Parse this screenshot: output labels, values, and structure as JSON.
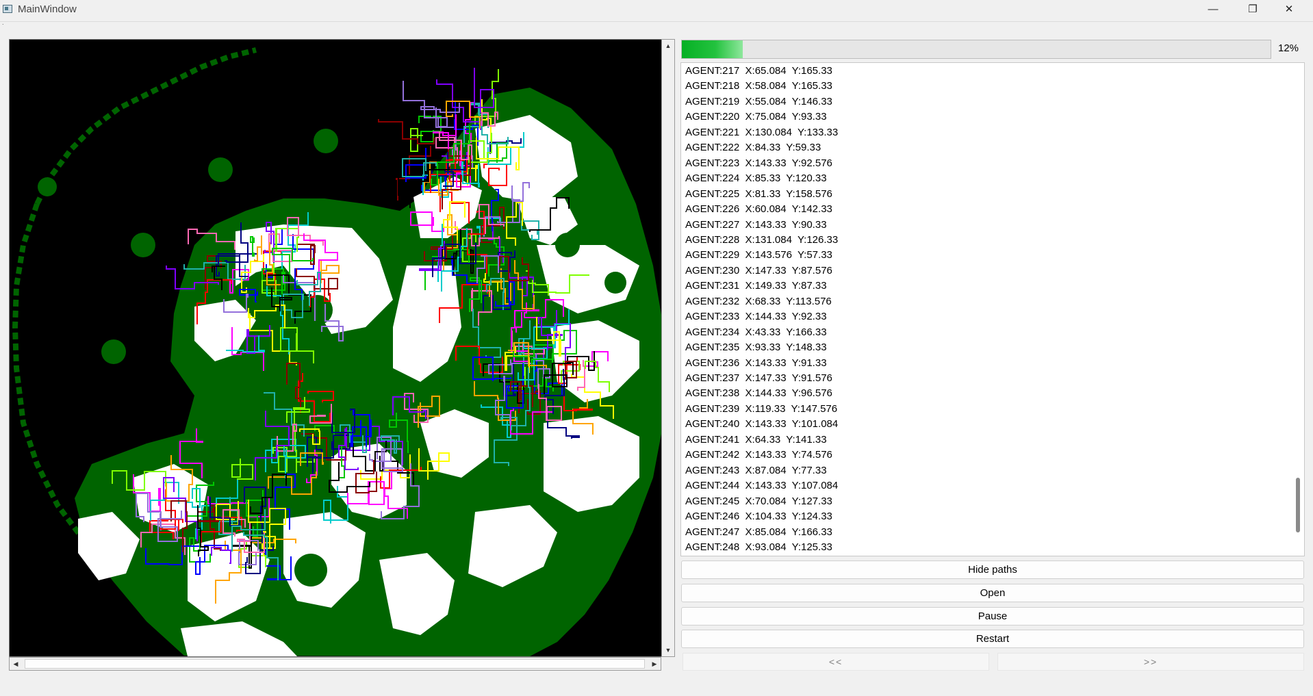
{
  "window": {
    "title": "MainWindow",
    "controls": {
      "minimize": "—",
      "restore": "❐",
      "close": "✕"
    },
    "menu_marker": "."
  },
  "progress": {
    "value": 0.12,
    "label": "12%",
    "fill_color": "#06b025"
  },
  "agents": [
    {
      "label": "AGENT:217  X:65.084  Y:165.33"
    },
    {
      "label": "AGENT:218  X:58.084  Y:165.33"
    },
    {
      "label": "AGENT:219  X:55.084  Y:146.33"
    },
    {
      "label": "AGENT:220  X:75.084  Y:93.33"
    },
    {
      "label": "AGENT:221  X:130.084  Y:133.33"
    },
    {
      "label": "AGENT:222  X:84.33  Y:59.33"
    },
    {
      "label": "AGENT:223  X:143.33  Y:92.576"
    },
    {
      "label": "AGENT:224  X:85.33  Y:120.33"
    },
    {
      "label": "AGENT:225  X:81.33  Y:158.576"
    },
    {
      "label": "AGENT:226  X:60.084  Y:142.33"
    },
    {
      "label": "AGENT:227  X:143.33  Y:90.33"
    },
    {
      "label": "AGENT:228  X:131.084  Y:126.33"
    },
    {
      "label": "AGENT:229  X:143.576  Y:57.33"
    },
    {
      "label": "AGENT:230  X:147.33  Y:87.576"
    },
    {
      "label": "AGENT:231  X:149.33  Y:87.33"
    },
    {
      "label": "AGENT:232  X:68.33  Y:113.576"
    },
    {
      "label": "AGENT:233  X:144.33  Y:92.33"
    },
    {
      "label": "AGENT:234  X:43.33  Y:166.33"
    },
    {
      "label": "AGENT:235  X:93.33  Y:148.33"
    },
    {
      "label": "AGENT:236  X:143.33  Y:91.33"
    },
    {
      "label": "AGENT:237  X:147.33  Y:91.576"
    },
    {
      "label": "AGENT:238  X:144.33  Y:96.576"
    },
    {
      "label": "AGENT:239  X:119.33  Y:147.576"
    },
    {
      "label": "AGENT:240  X:143.33  Y:101.084"
    },
    {
      "label": "AGENT:241  X:64.33  Y:141.33"
    },
    {
      "label": "AGENT:242  X:143.33  Y:74.576"
    },
    {
      "label": "AGENT:243  X:87.084  Y:77.33"
    },
    {
      "label": "AGENT:244  X:143.33  Y:107.084"
    },
    {
      "label": "AGENT:245  X:70.084  Y:127.33"
    },
    {
      "label": "AGENT:246  X:104.33  Y:124.33"
    },
    {
      "label": "AGENT:247  X:85.084  Y:166.33"
    },
    {
      "label": "AGENT:248  X:93.084  Y:125.33"
    }
  ],
  "buttons": {
    "hide_paths": "Hide paths",
    "open": "Open",
    "pause": "Pause",
    "restart": "Restart",
    "prev": "<<",
    "next": ">>"
  },
  "scrollbars": {
    "up": "▲",
    "down": "▼",
    "left": "◀",
    "right": "▶"
  },
  "map": {
    "background_color": "#000000",
    "vegetation_color": "#006400",
    "open_area_color": "#ffffff",
    "path_colors": [
      "#ff0000",
      "#0000ff",
      "#00c800",
      "#ff00ff",
      "#00cccc",
      "#ffa500",
      "#8000ff",
      "#7fff00",
      "#ffff00",
      "#8b0000",
      "#000080",
      "#ff69b4",
      "#000000",
      "#9370db",
      "#20b2aa"
    ]
  }
}
